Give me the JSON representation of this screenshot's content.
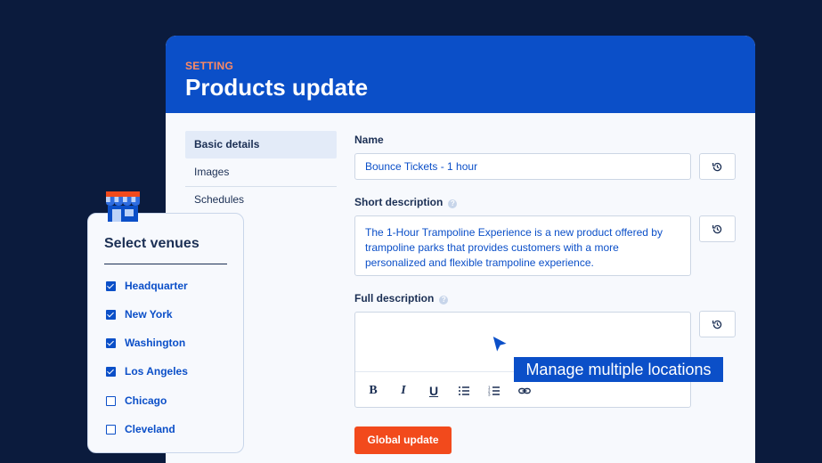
{
  "header": {
    "eyebrow": "SETTING",
    "title": "Products update"
  },
  "nav": {
    "items": [
      {
        "label": "Basic details",
        "active": true
      },
      {
        "label": "Images",
        "active": false
      },
      {
        "label": "Schedules",
        "active": false
      }
    ]
  },
  "form": {
    "name": {
      "label": "Name",
      "value": "Bounce Tickets - 1 hour"
    },
    "short_description": {
      "label": "Short description",
      "value": "The 1-Hour Trampoline Experience is a new product offered by trampoline parks that provides customers with a more personalized and flexible trampoline experience."
    },
    "full_description": {
      "label": "Full description",
      "value": ""
    },
    "toolbar": [
      "bold-icon",
      "italic-icon",
      "underline-icon",
      "bulleted-list-icon",
      "numbered-list-icon",
      "link-icon"
    ],
    "submit_label": "Global update"
  },
  "tooltip": {
    "text": "Manage multiple locations"
  },
  "venues": {
    "title": "Select venues",
    "items": [
      {
        "label": "Headquarter",
        "checked": true
      },
      {
        "label": "New York",
        "checked": true
      },
      {
        "label": "Washington",
        "checked": true
      },
      {
        "label": "Los Angeles",
        "checked": true
      },
      {
        "label": "Chicago",
        "checked": false
      },
      {
        "label": "Cleveland",
        "checked": false
      }
    ]
  },
  "colors": {
    "background": "#0b1b3d",
    "primary": "#0b4fc8",
    "accent": "#f24a1c",
    "eyebrow": "#ff8a62"
  }
}
